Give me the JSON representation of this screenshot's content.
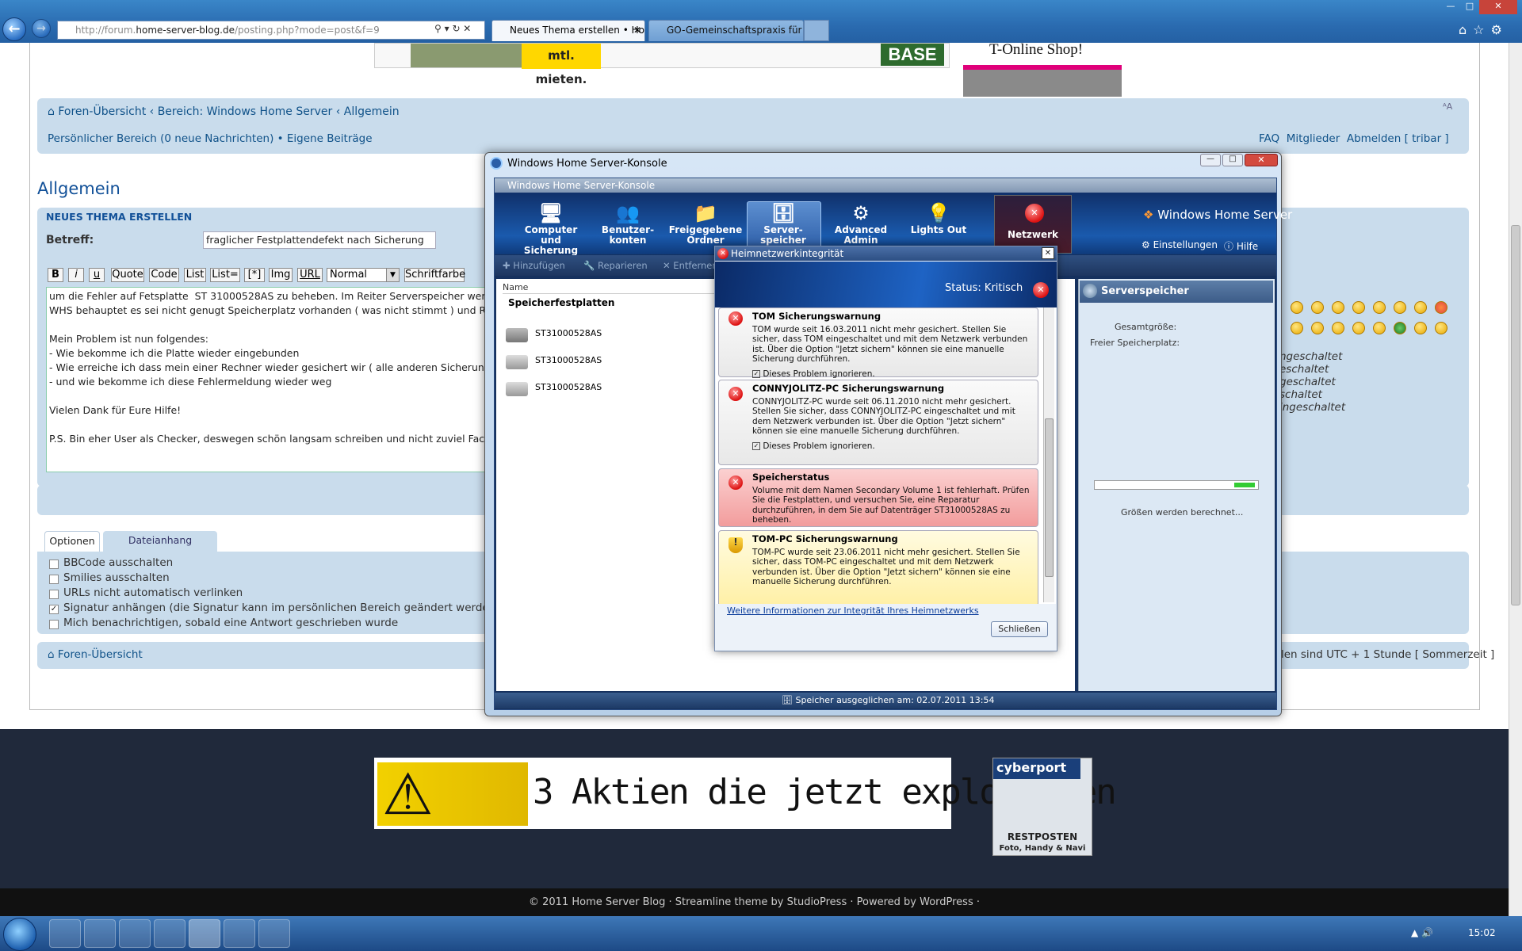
{
  "browser": {
    "address": {
      "prefix": "http://forum.",
      "domain": "home-server-blog.de",
      "path": "/posting.php?mode=post&f=9"
    },
    "tabs": [
      {
        "label": "Neues Thema erstellen • Ho...",
        "active": true
      },
      {
        "label": "GO-Gemeinschaftspraxis für O...",
        "active": false
      }
    ]
  },
  "ads": {
    "top_left_text": "mtl. mieten.",
    "top_left_brand": "BASE",
    "top_right": "T-Online Shop!",
    "banner": "3 Aktien die jetzt explodieren",
    "cyberport": {
      "brand": "cyberport",
      "line1": "RESTPOSTEN",
      "line2": "Foto, Handy & Navi"
    }
  },
  "forum": {
    "breadcrumb": [
      "Foren-Übersicht",
      "Bereich: Windows Home Server",
      "Allgemein"
    ],
    "personal": "Persönlicher Bereich (0 neue Nachrichten)",
    "own_posts": "Eigene Beiträge",
    "right_links": {
      "faq": "FAQ",
      "members": "Mitglieder",
      "logout": "Abmelden [ tribar ]"
    },
    "font_resize": "ᴬA",
    "page_title": "Allgemein",
    "form_title": "NEUES THEMA ERSTELLEN",
    "subject_label": "Betreff:",
    "subject_value": "fraglicher Festplattendefekt nach Sicherung",
    "toolbar": [
      "B",
      "i",
      "u",
      "Quote",
      "Code",
      "List",
      "List=",
      "[*]",
      "Img",
      "URL"
    ],
    "font_size_select": "Normal",
    "font_color_button": "Schriftfarbe",
    "body_text": "um die Fehler auf Fetsplatte  ST 31000528AS zu beheben. Im Reiter Serverspeicher werden a\nWHS behauptet es sei nicht genugt Speicherplatz vorhanden ( was nicht stimmt ) und Reparie\n\nMein Problem ist nun folgendes:\n- Wie bekomme ich die Platte wieder eingebunden\n- Wie erreiche ich dass mein einer Rechner wieder gesichert wir ( alle anderen Sicherungen g\n- und wie bekomme ich diese Fehlermeldung wieder weg\n\nVielen Dank für Eure Hilfe!\n\nP.S. Bin eher User als Checker, deswegen schön langsam schreiben und nicht zuviel Fachchin",
    "tabs": [
      "Optionen",
      "Dateianhang hochladen"
    ],
    "options": [
      {
        "label": "BBCode ausschalten",
        "checked": false
      },
      {
        "label": "Smilies ausschalten",
        "checked": false
      },
      {
        "label": "URLs nicht automatisch verlinken",
        "checked": false
      },
      {
        "label": "Signatur anhängen (die Signatur kann im persönlichen Bereich geändert werde",
        "checked": true
      },
      {
        "label": "Mich benachrichtigen, sobald eine Antwort geschrieben wurde",
        "checked": false
      }
    ],
    "bbcode_status": [
      "ngeschaltet",
      "eschaltet",
      "geschaltet",
      "schaltet",
      "ingeschaltet"
    ],
    "footer_home": "Foren-Übersicht",
    "timezone": "len sind UTC + 1 Stunde [ Sommerzeit ]",
    "copyright": "© 2011 Home Server Blog · Streamline theme by StudioPress · Powered by WordPress ·"
  },
  "whs": {
    "outer_title": "Windows Home Server-Konsole",
    "inner_title": "Windows Home Server-Konsole",
    "brand": "Windows Home Server",
    "ribbon": [
      {
        "label": "Computer und Sicherung",
        "icon": "computer-icon"
      },
      {
        "label": "Benutzer-konten",
        "icon": "users-icon"
      },
      {
        "label": "Freigegebene Ordner",
        "icon": "folder-icon"
      },
      {
        "label": "Server-speicher",
        "icon": "server-icon"
      },
      {
        "label": "Advanced Admin Konsole",
        "icon": "gear-icon"
      },
      {
        "label": "Lights Out",
        "icon": "bulb-icon"
      }
    ],
    "network": "Netzwerk",
    "settings": "Einstellungen",
    "help": "Hilfe",
    "actions": [
      "Hinzufügen",
      "Reparieren",
      "Entfernen"
    ],
    "list_header": "Name",
    "section": "Speicherfestplatten",
    "drives": [
      "ST31000528AS",
      "ST31000528AS",
      "ST31000528AS"
    ],
    "storage_panel": {
      "title": "Serverspeicher",
      "total": "Gesamtgröße:",
      "free": "Freier Speicherplatz:",
      "calculating": "Größen werden berechnet..."
    },
    "statusbar": "Speicher ausgeglichen am: 02.07.2011 13:54"
  },
  "dialog": {
    "title": "Heimnetzwerkintegrität",
    "status": "Status: Kritisch",
    "items": [
      {
        "title": "TOM Sicherungswarnung",
        "text": "TOM wurde seit 16.03.2011 nicht mehr gesichert. Stellen Sie sicher, dass TOM eingeschaltet und mit dem Netzwerk verbunden ist. Über die Option \"Jetzt sichern\" können sie eine manuelle Sicherung durchführen.",
        "ignore": "Dieses Problem ignorieren.",
        "level": "error"
      },
      {
        "title": "CONNYJOLITZ-PC Sicherungswarnung",
        "text": "CONNYJOLITZ-PC wurde seit 06.11.2010 nicht mehr gesichert. Stellen Sie sicher, dass CONNYJOLITZ-PC eingeschaltet und mit dem Netzwerk verbunden ist. Über die Option \"Jetzt sichern\" können sie eine manuelle Sicherung durchführen.",
        "ignore": "Dieses Problem ignorieren.",
        "level": "error"
      },
      {
        "title": "Speicherstatus",
        "text": "Volume mit dem Namen Secondary Volume 1 ist fehlerhaft. Prüfen Sie die Festplatten, und versuchen Sie, eine Reparatur durchzuführen, in dem Sie auf Datenträger ST31000528AS zu beheben.",
        "level": "critical"
      },
      {
        "title": "TOM-PC Sicherungswarnung",
        "text": "TOM-PC wurde seit 23.06.2011 nicht mehr gesichert. Stellen Sie sicher, dass TOM-PC eingeschaltet und mit dem Netzwerk verbunden ist. Über die Option \"Jetzt sichern\" können sie eine manuelle Sicherung durchführen.",
        "level": "warning"
      }
    ],
    "more_info": "Weitere Informationen zur Integrität Ihres Heimnetzwerks",
    "close": "Schließen"
  },
  "taskbar": {
    "time": "15:02"
  },
  "colors": {
    "critical": "#f5b5b5",
    "warning": "#fff3b0",
    "forum_bar": "#c9dcec",
    "link": "#105289"
  }
}
